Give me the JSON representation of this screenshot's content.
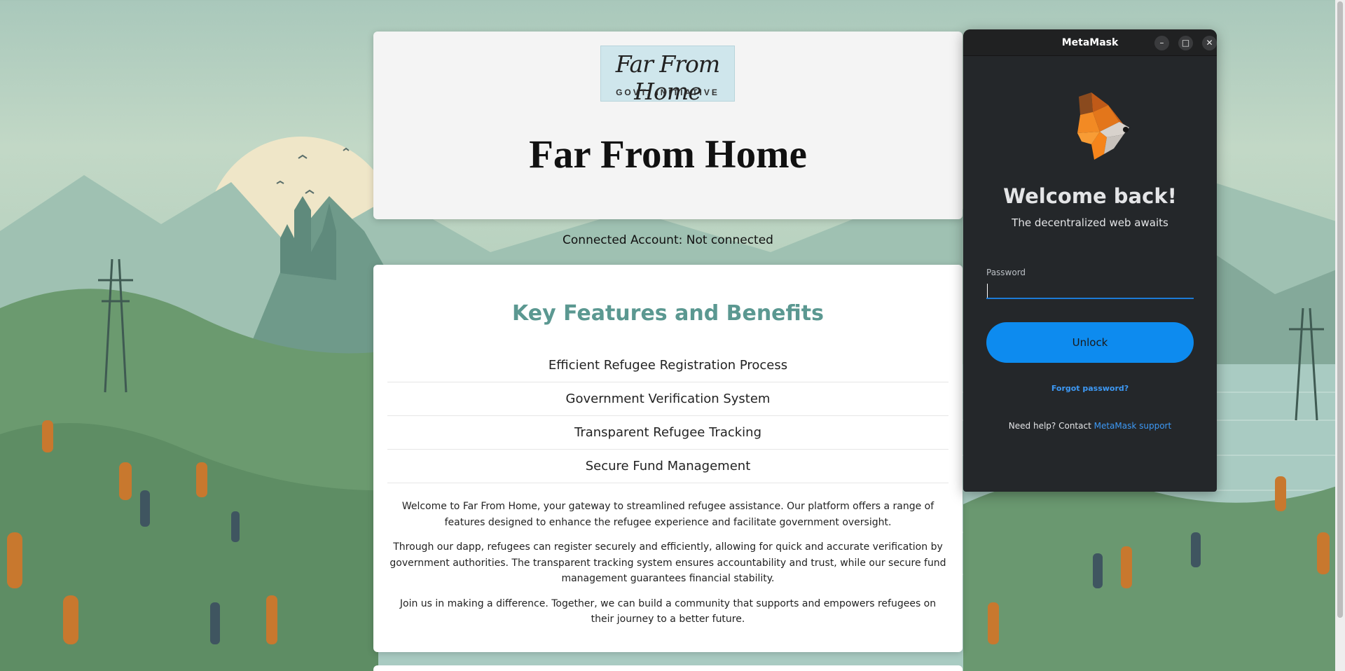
{
  "site": {
    "logo_script": "Far From Home",
    "logo_sub": "GOVT. INITIATIVE",
    "hero_title": "Far From Home",
    "connected_account": "Connected Account: Not connected",
    "section_title": "Key Features and Benefits",
    "features": [
      "Efficient Refugee Registration Process",
      "Government Verification System",
      "Transparent Refugee Tracking",
      "Secure Fund Management"
    ],
    "paragraphs": [
      "Welcome to Far From Home, your gateway to streamlined refugee assistance. Our platform offers a range of features designed to enhance the refugee experience and facilitate government oversight.",
      "Through our dapp, refugees can register securely and efficiently, allowing for quick and accurate verification by government authorities. The transparent tracking system ensures accountability and trust, while our secure fund management guarantees financial stability.",
      "Join us in making a difference. Together, we can build a community that supports and empowers refugees on their journey to a better future."
    ]
  },
  "metamask": {
    "window_title": "MetaMask",
    "minimize_glyph": "–",
    "maximize_glyph": "□",
    "close_glyph": "✕",
    "welcome": "Welcome back!",
    "tagline": "The decentralized web awaits",
    "password_label": "Password",
    "password_value": "",
    "unlock_label": "Unlock",
    "forgot_label": "Forgot password?",
    "help_text": "Need help? Contact ",
    "help_link": "MetaMask support"
  },
  "icons": {
    "fox": "metamask-fox-icon",
    "minimize": "minimize-icon",
    "maximize": "maximize-icon",
    "close": "close-icon"
  },
  "colors": {
    "section_title": "#5b9891",
    "unlock_button": "#0d8bef",
    "link": "#3d99f5",
    "metamask_bg": "#24272a",
    "input_underline": "#1c7ad6"
  }
}
